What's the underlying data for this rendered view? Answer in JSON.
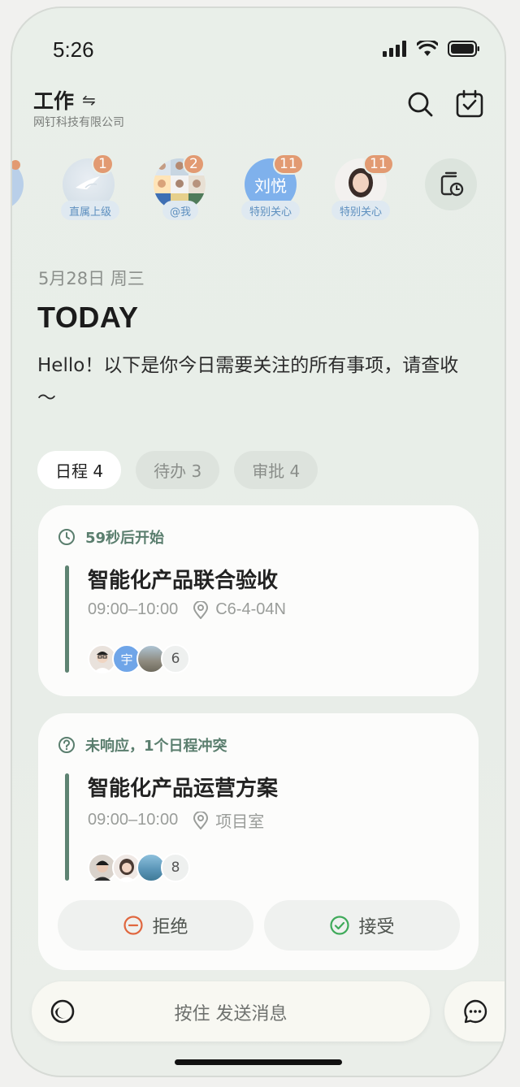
{
  "status": {
    "time": "5:26"
  },
  "header": {
    "title": "工作",
    "swap_icon": "⇋",
    "subtitle": "网钉科技有限公司"
  },
  "contacts": [
    {
      "badge": "1",
      "tag": "直属上级"
    },
    {
      "badge": "2",
      "tag": "@我"
    },
    {
      "badge": "11",
      "tag": "特别关心",
      "avatar_text": "刘悦"
    },
    {
      "badge": "11",
      "tag": "特别关心"
    }
  ],
  "date_line": "5月28日 周三",
  "today": "TODAY",
  "intro": "Hello！以下是你今日需要关注的所有事项，请查收～",
  "tabs": [
    {
      "label": "日程 4",
      "active": true
    },
    {
      "label": "待办 3",
      "active": false
    },
    {
      "label": "审批 4",
      "active": false
    }
  ],
  "cards": [
    {
      "status": "59秒后开始",
      "title": "智能化产品联合验收",
      "time": "09:00–10:00",
      "location": "C6-4-04N",
      "avatar_text": "宇",
      "count": "6"
    },
    {
      "status": "未响应，1个日程冲突",
      "title": "智能化产品运营方案",
      "time": "09:00–10:00",
      "location": "项目室",
      "count": "8",
      "reject_label": "拒绝",
      "accept_label": "接受"
    }
  ],
  "input": {
    "placeholder": "按住 发送消息"
  },
  "colors": {
    "accent_green": "#5e8372",
    "badge_orange": "#e29a72",
    "tag_blue": "#5d8fbf",
    "reject_red": "#e0673f",
    "accept_green": "#3faa5a"
  }
}
